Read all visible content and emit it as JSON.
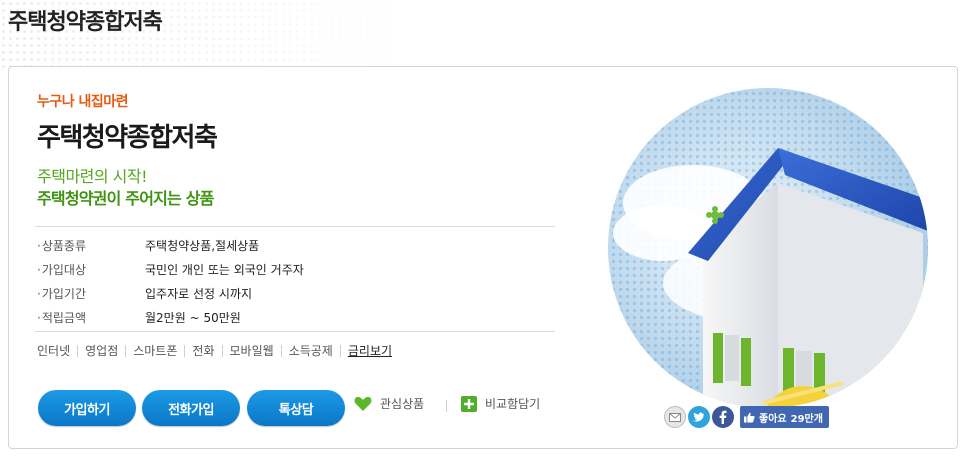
{
  "page": {
    "title": "주택청약종합저축"
  },
  "product": {
    "eyebrow": "누구나 내집마련",
    "name": "주택청약종합저축",
    "tagline1": "주택마련의 시작!",
    "tagline2": "주택청약권이 주어지는 상품"
  },
  "info": [
    {
      "key": "상품종류",
      "value": "주택청약상품,절세상품"
    },
    {
      "key": "가입대상",
      "value": "국민인 개인 또는 외국인 거주자"
    },
    {
      "key": "가입기간",
      "value": "입주자로 선정 시까지"
    },
    {
      "key": "적립금액",
      "value": "월2만원 ~ 50만원"
    }
  ],
  "channels": [
    "인터넷",
    "영업점",
    "스마트폰",
    "전화",
    "모바일웹",
    "소득공제",
    "금리보기"
  ],
  "buttons": {
    "join": "가입하기",
    "phone_join": "전화가입",
    "consult": "톡상담"
  },
  "actions": {
    "favorite": "관심상품",
    "compare": "비교함담기"
  },
  "share": {
    "like_label": "좋아요",
    "like_count": "29만개"
  },
  "colors": {
    "accent_blue": "#0a77c7",
    "eyebrow_orange": "#e45b13",
    "tagline_green": "#3f9313",
    "facebook": "#4267b2"
  },
  "icons": [
    "heart-icon",
    "plus-icon",
    "email-icon",
    "twitter-icon",
    "facebook-icon",
    "thumbs-up-icon"
  ]
}
